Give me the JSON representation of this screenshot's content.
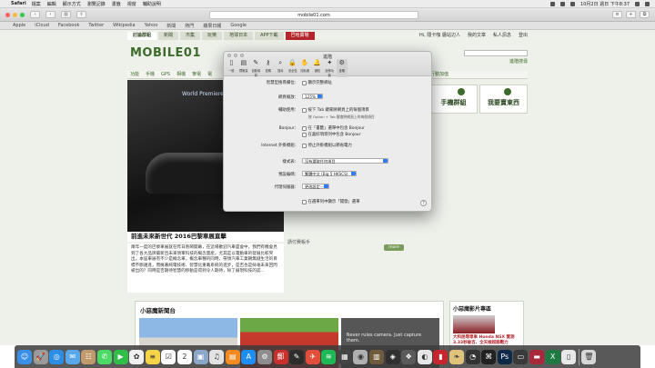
{
  "menubar": {
    "app_name": "Safari",
    "menus": [
      "檔案",
      "編輯",
      "顯示方式",
      "瀏覽記錄",
      "書籤",
      "視窗",
      "輔助說明"
    ],
    "clock": "10月2日 週日 下午8:37"
  },
  "safari": {
    "url": "mobile01.com"
  },
  "favorites": [
    "Apple",
    "iCloud",
    "Facebook",
    "Twitter",
    "Wikipedia",
    "Yahoo",
    "新聞",
    "熱門",
    "蘋果日報",
    "Google"
  ],
  "site": {
    "nav_tabs": [
      {
        "label": "討論群組",
        "active": true
      },
      {
        "label": "新聞"
      },
      {
        "label": "市集"
      },
      {
        "label": "玩樂"
      },
      {
        "label": "地球日本"
      },
      {
        "label": "APP下載"
      },
      {
        "label": "巴哈賣場",
        "red": true
      }
    ],
    "nav_right": [
      "Hi, 隱卡咖 廳站辺人",
      "我的文章",
      "私人訊息",
      "登出"
    ],
    "logo": "MOBILE01",
    "advanced_search": "進階搜尋",
    "categories": [
      "功能",
      "手機",
      "GPS",
      "相機",
      "筆電",
      "電"
    ],
    "categories_extra": "行動加值",
    "hero_caption": "前進未來新世代 2016巴黎車展直擊",
    "hero_banner": "World Premiere",
    "summary": "兩年一度的巴黎車展就在昨日熱鬧開幕，在這場歡迎汽車盛會中，我們有機會見到了各大品牌最新且未來領軍科技的概念量産。尤其是以電動車的發展比較突出，本屆車展有不少是概念車，概念車種的同時，帶領汽車工業朝無縫生活的目標不斷邁進，而擁著純電技術、智慧化重載系統的進步，是否也是絲毫未來回閃被出的？同時是否期待智慧的移動是得到令人期待，除了展現科技的認...",
    "right_boxes": [
      "手機群組",
      "我要賣東西"
    ],
    "group_text": "請付費帳手",
    "more_label": "more",
    "news_header": "小惡魔新聞台",
    "news_thumb_text": "Never rules camera. Just capture them.",
    "video_header": "小惡魔影片專區",
    "video_caption": "大和屈辱眾車 Honda NSX 實測 3.33秒破百、全天候超跑戰力"
  },
  "prefs": {
    "title": "進階",
    "tabs": [
      {
        "label": "一般",
        "icon": "switch-icon"
      },
      {
        "label": "標籤頁",
        "icon": "tabs-icon"
      },
      {
        "label": "自動填寫",
        "icon": "pencil-icon"
      },
      {
        "label": "密碼",
        "icon": "key-icon"
      },
      {
        "label": "搜尋",
        "icon": "magnifier-icon"
      },
      {
        "label": "安全性",
        "icon": "lock-icon"
      },
      {
        "label": "隱私權",
        "icon": "hand-icon"
      },
      {
        "label": "通知",
        "icon": "bell-icon"
      },
      {
        "label": "延伸功能",
        "icon": "puzzle-icon"
      },
      {
        "label": "進階",
        "icon": "gear-icon",
        "active": true
      }
    ],
    "rows": {
      "smart_search_label": "智慧型搜尋欄位：",
      "smart_search_value": "顯示完整網址",
      "zoom_label": "網頁縮放：",
      "zoom_value": "125%",
      "accessibility_label": "輔助使用：",
      "accessibility_value": "按下 Tab 鍵來將網頁上的每個項目",
      "accessibility_hint": "按 Option + Tab 鍵會將網頁上的每個項目",
      "bonjour_label": "Bonjour：",
      "bonjour_value1": "在「書籤」選單中包含 Bonjour",
      "bonjour_value2": "在喜好項目列中包含 Bonjour",
      "plugins_label": "Internet 外掛模組：",
      "plugins_value": "停止外掛模組以節省電力",
      "stylesheet_label": "樣式表：",
      "stylesheet_value": "沒有選取任何項目",
      "encoding_label": "預設編碼：",
      "encoding_value": "繁體中文 (Big 5 HKSCS)",
      "proxy_label": "代理伺服器：",
      "proxy_value": "更改設定⋯",
      "developer_value": "在選單列中顯示「開發」選單"
    }
  },
  "dock": [
    {
      "name": "finder-icon",
      "color": "#3a8fe6",
      "glyph": "☺"
    },
    {
      "name": "launchpad-icon",
      "color": "#9a9a9a",
      "glyph": "🚀"
    },
    {
      "name": "safari-icon",
      "color": "#2c8de6",
      "glyph": "◎"
    },
    {
      "name": "mail-icon",
      "color": "#5aa7ea",
      "glyph": "✉"
    },
    {
      "name": "contacts-icon",
      "color": "#c19a6b",
      "glyph": "☷"
    },
    {
      "name": "messages-icon",
      "color": "#4cd964",
      "glyph": "✆"
    },
    {
      "name": "facetime-icon",
      "color": "#2fbf48",
      "glyph": "▶"
    },
    {
      "name": "photos-icon",
      "color": "#f0f0f0",
      "glyph": "✿"
    },
    {
      "name": "notes-icon",
      "color": "#f6d44a",
      "glyph": "≡"
    },
    {
      "name": "reminders-icon",
      "color": "#ffffff",
      "glyph": "☑"
    },
    {
      "name": "calendar-icon",
      "color": "#ffffff",
      "glyph": "2"
    },
    {
      "name": "preview-icon",
      "color": "#8aa6c8",
      "glyph": "▣"
    },
    {
      "name": "itunes-icon",
      "color": "#e2e2e2",
      "glyph": "♫"
    },
    {
      "name": "ibooks-icon",
      "color": "#f28a1f",
      "glyph": "▤"
    },
    {
      "name": "appstore-icon",
      "color": "#1c8ef5",
      "glyph": "A"
    },
    {
      "name": "sysprefs-icon",
      "color": "#8d8d8d",
      "glyph": "⚙"
    },
    {
      "name": "app-icon",
      "color": "#c9302c",
      "glyph": "郵"
    },
    {
      "name": "app-icon",
      "color": "#2d2d2d",
      "glyph": "✎"
    },
    {
      "name": "app-icon",
      "color": "#e34e3b",
      "glyph": "✈"
    },
    {
      "name": "spotify-icon",
      "color": "#1db954",
      "glyph": "≋"
    },
    {
      "name": "app-icon",
      "color": "#444",
      "glyph": "▦"
    },
    {
      "name": "app-icon",
      "color": "#b0b0b0",
      "glyph": "◉"
    },
    {
      "name": "app-icon",
      "color": "#705a3c",
      "glyph": "▥"
    },
    {
      "name": "app-icon",
      "color": "#303030",
      "glyph": "◈"
    },
    {
      "name": "app-icon",
      "color": "#5a5a5a",
      "glyph": "❖"
    },
    {
      "name": "app-icon",
      "color": "#e6e6e6",
      "glyph": "◐"
    },
    {
      "name": "app-icon",
      "color": "#c8262f",
      "glyph": "▮"
    },
    {
      "name": "app-icon",
      "color": "#e0c27a",
      "glyph": "❧"
    },
    {
      "name": "app-icon",
      "color": "#333",
      "glyph": "◔"
    },
    {
      "name": "app-icon",
      "color": "#222",
      "glyph": "⌘"
    },
    {
      "name": "photoshop-icon",
      "color": "#0f2a48",
      "glyph": "Ps"
    },
    {
      "name": "app-icon",
      "color": "#3a3a3a",
      "glyph": "▭"
    },
    {
      "name": "app-icon",
      "color": "#a82a3a",
      "glyph": "▬"
    },
    {
      "name": "excel-icon",
      "color": "#1d7b41",
      "glyph": "X"
    },
    {
      "name": "app-icon",
      "color": "#e8e8e8",
      "glyph": "▯"
    },
    {
      "name": "trash-icon",
      "color": "#d7d7d7",
      "glyph": "🗑"
    }
  ]
}
